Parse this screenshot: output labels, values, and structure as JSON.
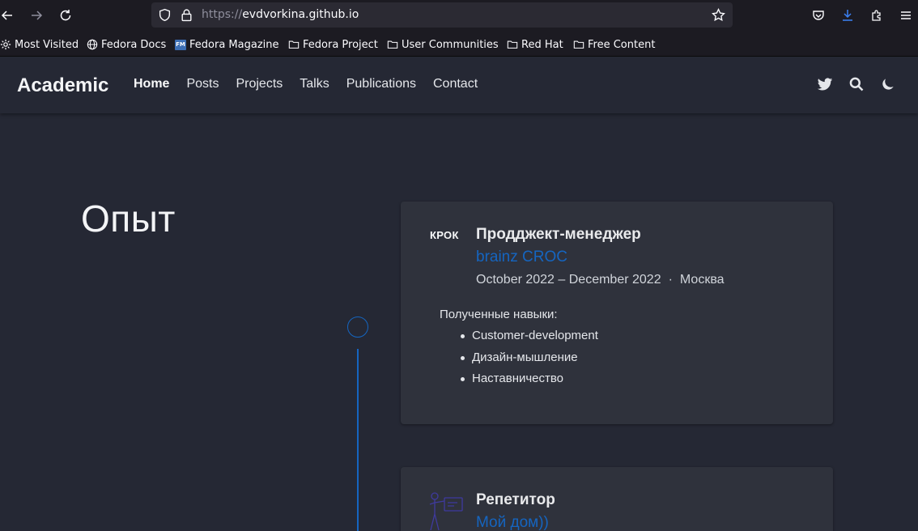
{
  "browser": {
    "url_scheme": "https://",
    "url_host": "evdvorkina.github.io",
    "bookmarks": [
      {
        "label": "Most Visited",
        "icon": "gear-icon"
      },
      {
        "label": "Fedora Docs",
        "icon": "globe-icon"
      },
      {
        "label": "Fedora Magazine",
        "icon": "fedora-magazine-icon",
        "badge": "FM"
      },
      {
        "label": "Fedora Project",
        "icon": "folder-icon"
      },
      {
        "label": "User Communities",
        "icon": "folder-icon"
      },
      {
        "label": "Red Hat",
        "icon": "folder-icon"
      },
      {
        "label": "Free Content",
        "icon": "folder-icon"
      }
    ]
  },
  "site": {
    "brand": "Academic",
    "nav": [
      "Home",
      "Posts",
      "Projects",
      "Talks",
      "Publications",
      "Contact"
    ],
    "active_nav": "Home"
  },
  "section": {
    "title": "Опыт"
  },
  "experience": [
    {
      "logo_text": "КРОК",
      "title": "Продджект-менеджер",
      "company": "brainz CROC",
      "date_range": "October 2022 – December 2022",
      "separator": "·",
      "location": "Москва",
      "skills_heading": "Полученные навыки:",
      "skills": [
        "Customer-development",
        "Дизайн-мышление",
        "Наставничество"
      ]
    },
    {
      "title": "Репетитор",
      "company": "Мой дом))"
    }
  ],
  "colors": {
    "background": "#252834",
    "card": "#2f323c",
    "accent": "#1565c0"
  }
}
